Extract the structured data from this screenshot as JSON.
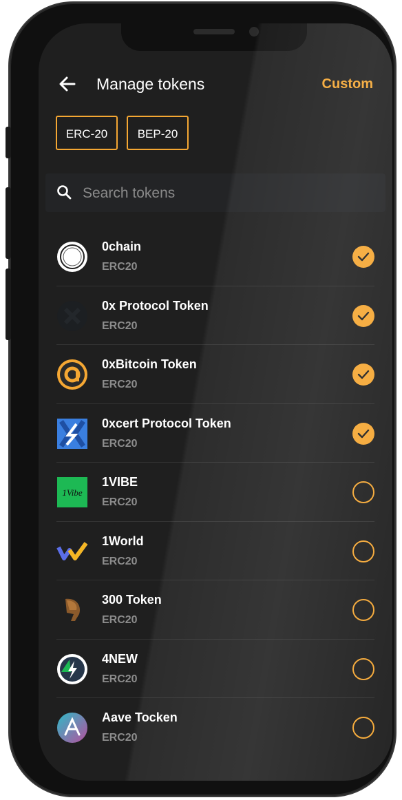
{
  "header": {
    "back_icon": "arrow-left-icon",
    "title": "Manage tokens",
    "custom_label": "Custom"
  },
  "filters": [
    {
      "label": "ERC-20"
    },
    {
      "label": "BEP-20"
    }
  ],
  "search": {
    "placeholder": "Search tokens",
    "value": ""
  },
  "colors": {
    "accent": "#f5a733",
    "background": "#1f1f1f",
    "text": "#ffffff",
    "muted": "#8c8c8c"
  },
  "tokens": [
    {
      "name": "0chain",
      "network": "ERC20",
      "selected": true,
      "icon": "0chain-logo-icon"
    },
    {
      "name": "0x Protocol Token",
      "network": "ERC20",
      "selected": true,
      "icon": "0x-logo-icon"
    },
    {
      "name": "0xBitcoin Token",
      "network": "ERC20",
      "selected": true,
      "icon": "0xbitcoin-logo-icon"
    },
    {
      "name": "0xcert Protocol Token",
      "network": "ERC20",
      "selected": true,
      "icon": "0xcert-logo-icon"
    },
    {
      "name": "1VIBE",
      "network": "ERC20",
      "selected": false,
      "icon": "1vibe-logo-icon"
    },
    {
      "name": "1World",
      "network": "ERC20",
      "selected": false,
      "icon": "1world-logo-icon"
    },
    {
      "name": "300 Token",
      "network": "ERC20",
      "selected": false,
      "icon": "300-token-logo-icon"
    },
    {
      "name": "4NEW",
      "network": "ERC20",
      "selected": false,
      "icon": "4new-logo-icon"
    },
    {
      "name": "Aave Tocken",
      "network": "ERC20",
      "selected": false,
      "icon": "aave-logo-icon"
    }
  ]
}
